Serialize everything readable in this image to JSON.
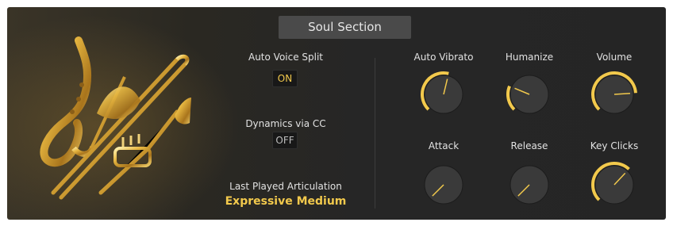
{
  "title": "Soul Section",
  "left_controls": {
    "auto_voice_split": {
      "label": "Auto Voice Split",
      "value": "ON"
    },
    "dynamics_via_cc": {
      "label": "Dynamics via CC",
      "value": "OFF"
    },
    "last_played_articulation": {
      "label": "Last Played Articulation",
      "value": "Expressive Medium"
    }
  },
  "knobs": [
    {
      "id": "auto-vibrato",
      "label": "Auto Vibrato",
      "level": 0.55
    },
    {
      "id": "humanize",
      "label": "Humanize",
      "level": 0.25
    },
    {
      "id": "volume",
      "label": "Volume",
      "level": 0.82
    },
    {
      "id": "attack",
      "label": "Attack",
      "level": 0.0
    },
    {
      "id": "release",
      "label": "Release",
      "level": 0.0
    },
    {
      "id": "key-clicks",
      "label": "Key Clicks",
      "level": 0.66
    }
  ],
  "colors": {
    "accent": "#f2c94c",
    "panel": "#262626",
    "knob": "#3a3a3a"
  },
  "icons": {
    "instruments_image": "saxophone-trombone-trumpet-image"
  }
}
